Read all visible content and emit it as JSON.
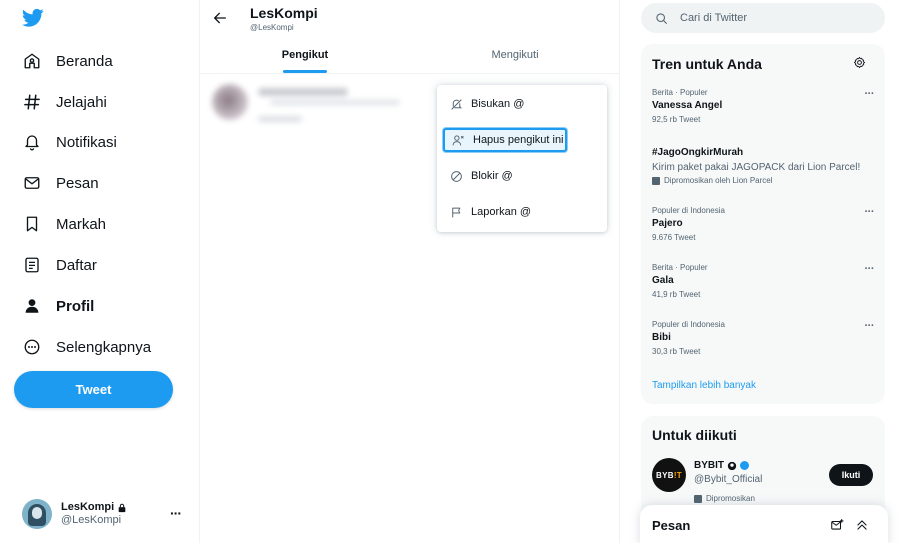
{
  "nav": {
    "items": [
      {
        "label": "Beranda",
        "icon": "home-icon"
      },
      {
        "label": "Jelajahi",
        "icon": "hashtag-icon"
      },
      {
        "label": "Notifikasi",
        "icon": "bell-icon"
      },
      {
        "label": "Pesan",
        "icon": "envelope-icon"
      },
      {
        "label": "Markah",
        "icon": "bookmark-icon"
      },
      {
        "label": "Daftar",
        "icon": "list-icon"
      },
      {
        "label": "Profil",
        "icon": "person-icon",
        "active": true
      },
      {
        "label": "Selengkapnya",
        "icon": "more-circle-icon"
      }
    ],
    "tweet_label": "Tweet",
    "account": {
      "name": "LesKompi",
      "handle": "@LesKompi",
      "more": "···"
    }
  },
  "profile": {
    "name": "LesKompi",
    "handle": "@LesKompi"
  },
  "tabs": [
    {
      "label": "Pengikut",
      "active": true
    },
    {
      "label": "Mengikuti",
      "active": false
    }
  ],
  "menu": {
    "items": [
      {
        "label": "Bisukan @",
        "icon": "mute-icon"
      },
      {
        "label": "Hapus pengikut ini",
        "icon": "remove-follower-icon",
        "focused": true
      },
      {
        "label": "Blokir @",
        "icon": "block-icon"
      },
      {
        "label": "Laporkan @",
        "icon": "flag-icon"
      }
    ]
  },
  "search": {
    "placeholder": "Cari di Twitter"
  },
  "trends": {
    "title": "Tren untuk Anda",
    "items": [
      {
        "meta": "Berita · Populer",
        "name": "Vanessa Angel",
        "count": "92,5 rb Tweet"
      },
      {
        "meta": "Populer di Indonesia",
        "name": "Pajero",
        "count": "9.676 Tweet"
      },
      {
        "meta": "Berita · Populer",
        "name": "Gala",
        "count": "41,9 rb Tweet"
      },
      {
        "meta": "Populer di Indonesia",
        "name": "Bibi",
        "count": "30,3 rb Tweet"
      }
    ],
    "promoted": {
      "name": "#JagoOngkirMurah",
      "desc": "Kirim paket pakai JAGOPACK dari Lion Parcel!",
      "by": "Dipromosikan oleh Lion Parcel"
    },
    "more_dots": "···",
    "show_more": "Tampilkan lebih banyak"
  },
  "follow": {
    "title": "Untuk diikuti",
    "account": {
      "name": "BYBIT",
      "handle": "@Bybit_Official",
      "promo": "Dipromosikan",
      "button": "Ikuti",
      "avatar_text_a": "BYB",
      "avatar_text_b": "!T"
    }
  },
  "messages": {
    "title": "Pesan"
  },
  "colors": {
    "accent": "#1d9bf0",
    "text": "#0f1419",
    "muted": "#536471"
  }
}
